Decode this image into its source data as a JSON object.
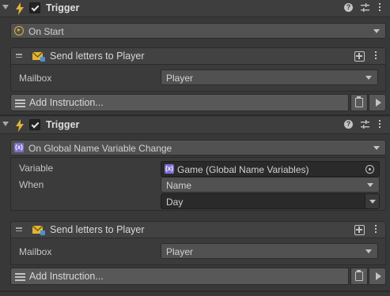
{
  "colors": {
    "accent": "#e0b33a",
    "variable_badge": "#7c6ed2",
    "background": "#383838"
  },
  "triggers": [
    {
      "title": "Trigger",
      "enabled": true,
      "event": "On Start",
      "event_icon": "play-circle-icon",
      "instruction": {
        "title": "Send letters to Player",
        "field_label": "Mailbox",
        "field_value": "Player"
      },
      "add_instruction_label": "Add Instruction..."
    },
    {
      "title": "Trigger",
      "enabled": true,
      "event": "On Global Name Variable Change",
      "event_icon": "global-variable-icon",
      "variable_label": "Variable",
      "variable_value": "Game (Global Name Variables)",
      "when_label": "When",
      "when_value": "Name",
      "name_value": "Day",
      "instruction": {
        "title": "Send letters to Player",
        "field_label": "Mailbox",
        "field_value": "Player"
      },
      "add_instruction_label": "Add Instruction..."
    }
  ],
  "icons": {
    "help": "?",
    "variable_badge": "(x)",
    "drag": "="
  }
}
